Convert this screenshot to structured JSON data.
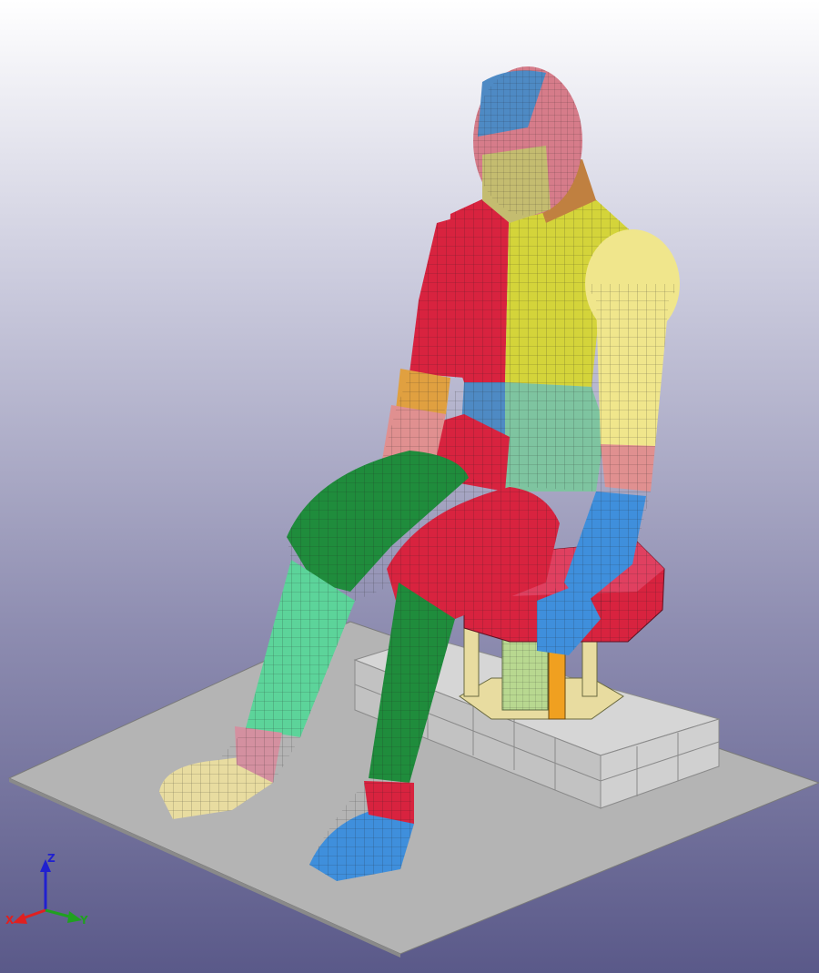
{
  "viewport": {
    "background_top": "#ffffff",
    "background_bottom": "#5a5989"
  },
  "model": {
    "colors": {
      "floor": "#b4b4b4",
      "pedestal": "#d6d6d6",
      "seat": "#d8233f",
      "seat_stand": "#e8dca0",
      "seat_post": "#f0a020",
      "head": "#d67c8a",
      "torso_left": "#d8233f",
      "torso_right": "#d4d43a",
      "abdomen": "#4e8ac4",
      "pelvis": "#7ec4a0",
      "upper_arm_right": "#f0e68c",
      "forearm_right": "#3f8fdc",
      "forearm_left": "#e09090",
      "thigh_left": "#1f8c3c",
      "thigh_right": "#d8233f",
      "shin_left": "#5cd49a",
      "shin_right": "#1f8c3c",
      "foot_left": "#e8dca0",
      "foot_right": "#3f8fdc",
      "mesh": "#202020"
    }
  },
  "triad": {
    "x_label": "X",
    "y_label": "Y",
    "z_label": "Z",
    "x_color": "#e02020",
    "y_color": "#20a020",
    "z_color": "#2020d0"
  }
}
